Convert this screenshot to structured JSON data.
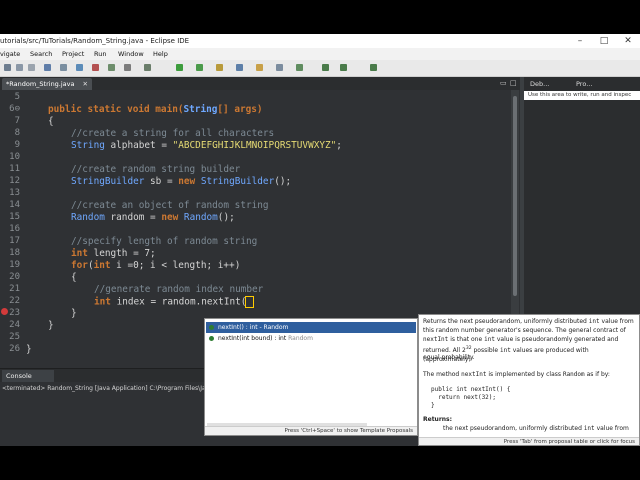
{
  "window": {
    "title": "utorials/src/TuTorials/Random_String.java - Eclipse IDE",
    "minimize": "–",
    "maximize": "□",
    "close": "✕"
  },
  "menu": [
    "vigate",
    "Search",
    "Project",
    "Run",
    "Window",
    "Help"
  ],
  "editor_tab": {
    "label": "*Random_String.java",
    "close": "✕"
  },
  "right_tabs": [
    {
      "label": "Deb..."
    },
    {
      "label": "Pro..."
    }
  ],
  "right_info": "Use this area to write, run and inspec",
  "code_lines": [
    {
      "n": "5",
      "text": ""
    },
    {
      "n": "6⊖",
      "text": "public static void main(String[] args)"
    },
    {
      "n": "7",
      "text": "{"
    },
    {
      "n": "8",
      "text": "//create a string for all characters"
    },
    {
      "n": "9",
      "text": "String alphabet = \"ABCDEFGHIJKLMNOIPQRSTUVWXYZ\";"
    },
    {
      "n": "10",
      "text": ""
    },
    {
      "n": "11",
      "text": "//create random string builder"
    },
    {
      "n": "12",
      "text": "StringBuilder sb = new StringBuilder();"
    },
    {
      "n": "13",
      "text": ""
    },
    {
      "n": "14",
      "text": "//create an object of random string"
    },
    {
      "n": "15",
      "text": "Random random = new Random();"
    },
    {
      "n": "16",
      "text": ""
    },
    {
      "n": "17",
      "text": "//specify length of random string"
    },
    {
      "n": "18",
      "text": "int length = 7;"
    },
    {
      "n": "19",
      "text": "for(int i =0; i < length; i++)"
    },
    {
      "n": "20",
      "text": "{"
    },
    {
      "n": "21",
      "text": "//generate random index number"
    },
    {
      "n": "22",
      "text": "int index = random.nextInt("
    },
    {
      "n": "23",
      "text": "}"
    },
    {
      "n": "24",
      "text": "}"
    },
    {
      "n": "25",
      "text": ""
    },
    {
      "n": "26",
      "text": "}"
    }
  ],
  "console": {
    "tab": "Console",
    "status": "<terminated> Random_String [Java Application] C:\\Program Files\\Ja"
  },
  "proposals": {
    "items": [
      {
        "name": "nextInt() : int - Random",
        "sig": "nextInt() : int",
        "owner": "Random"
      },
      {
        "name": "nextInt(int bound) : int - Random",
        "sig": "nextInt(int bound) : int",
        "owner": "Random"
      }
    ],
    "footer": "Press 'Ctrl+Space' to show Template Proposals"
  },
  "doc": {
    "p1a": "Returns the next pseudorandom, uniformly distributed",
    "p1b": "int",
    "p1c": "value from",
    "p2": "this random number generator's sequence. The general contract of",
    "p3a": "nextInt",
    "p3b": "is that one",
    "p3c": "int",
    "p3d": "value is pseudorandomly generated and",
    "p4a": "returned. All 2",
    "p4sup": "32",
    "p4b": "possible",
    "p4c": "int",
    "p4d": "values are produced with (approximately)",
    "p5": "equal probability.",
    "p6a": "The method",
    "p6b": "nextInt",
    "p6c": "is implemented by class",
    "p6d": "Random",
    "p6e": "as if by:",
    "code1": "public int nextInt() {",
    "code2": "  return next(32);",
    "code3": "}",
    "returns_label": "Returns:",
    "returns_text": "the next pseudorandom, uniformly distributed",
    "returns_int": "int",
    "returns_tail": "value from",
    "footer": "Press 'Tab' from proposal table or click for focus"
  },
  "colors": {
    "editor_bg": "#2f3134",
    "keyword": "#cc7832",
    "string": "#e6db74",
    "comment": "#7d8a94",
    "type": "#6fa8ff",
    "selection": "#2f5f9e"
  }
}
